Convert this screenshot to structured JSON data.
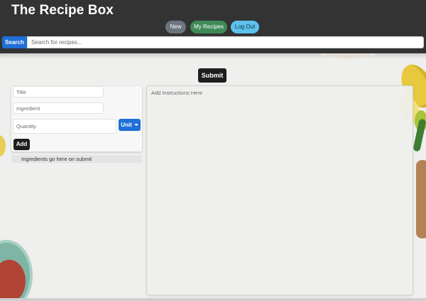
{
  "app": {
    "title": "The Recipe Box"
  },
  "nav": {
    "new_label": "New",
    "my_recipes_label": "My Recipes",
    "logout_label": "Log Out"
  },
  "search": {
    "button_label": "Search",
    "placeholder": "Search for recipes..."
  },
  "editor": {
    "submit_label": "Submit",
    "title_placeholder": "Title",
    "ingredient_placeholder": "Ingredient",
    "quantity_placeholder": "Quantity",
    "unit_label": "Unit",
    "add_label": "Add",
    "ingredients_hint": "Ingredients go here on submit",
    "instructions_placeholder": "Add Instructions Here"
  },
  "colors": {
    "header_bg": "#333333",
    "primary_blue": "#1f6fd6",
    "new_gray": "#6c757d",
    "my_recipes_green": "#3f8a57",
    "logout_cyan": "#5dc1ee",
    "dark_button": "#1e1e1e"
  },
  "icons": {
    "unit_dropdown": "caret-down-icon"
  }
}
